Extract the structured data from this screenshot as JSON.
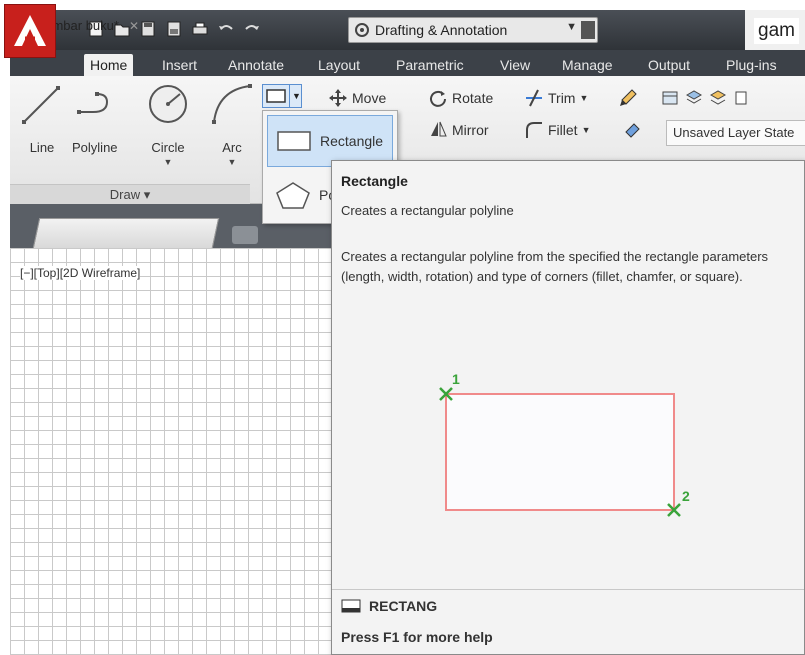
{
  "titlebar": {
    "workspace": "Drafting & Annotation",
    "title": "gam"
  },
  "ribbon_tabs": [
    "Home",
    "Insert",
    "Annotate",
    "Layout",
    "Parametric",
    "View",
    "Manage",
    "Output",
    "Plug-ins"
  ],
  "draw_panel": {
    "tools": [
      "Line",
      "Polyline",
      "Circle",
      "Arc"
    ],
    "panel_label": "Draw ▾"
  },
  "modify_panel": {
    "move": "Move",
    "rotate": "Rotate",
    "trim": "Trim",
    "mirror": "Mirror",
    "fillet": "Fillet"
  },
  "layers_panel": {
    "layer_state": "Unsaved Layer State"
  },
  "rect_dropdown": {
    "items": [
      "Rectangle",
      "Po"
    ]
  },
  "document": {
    "tab_name": "gambar buku*",
    "viewport_label": "[−][Top][2D Wireframe]"
  },
  "tooltip": {
    "title": "Rectangle",
    "short_desc": "Creates a rectangular polyline",
    "long_desc": "Creates a rectangular polyline from the specified the rectangle parameters (length, width, rotation) and type of corners (fillet, chamfer, or square).",
    "point1": "1",
    "point2": "2",
    "command": "RECTANG",
    "help": "Press F1 for more help"
  },
  "colors": {
    "accent_red": "#c8201c",
    "ribbon_dark": "#3c4148",
    "highlight_blue": "#cfe3f7",
    "rect_outline": "#f08a8a",
    "point_green": "#3aa33a"
  }
}
